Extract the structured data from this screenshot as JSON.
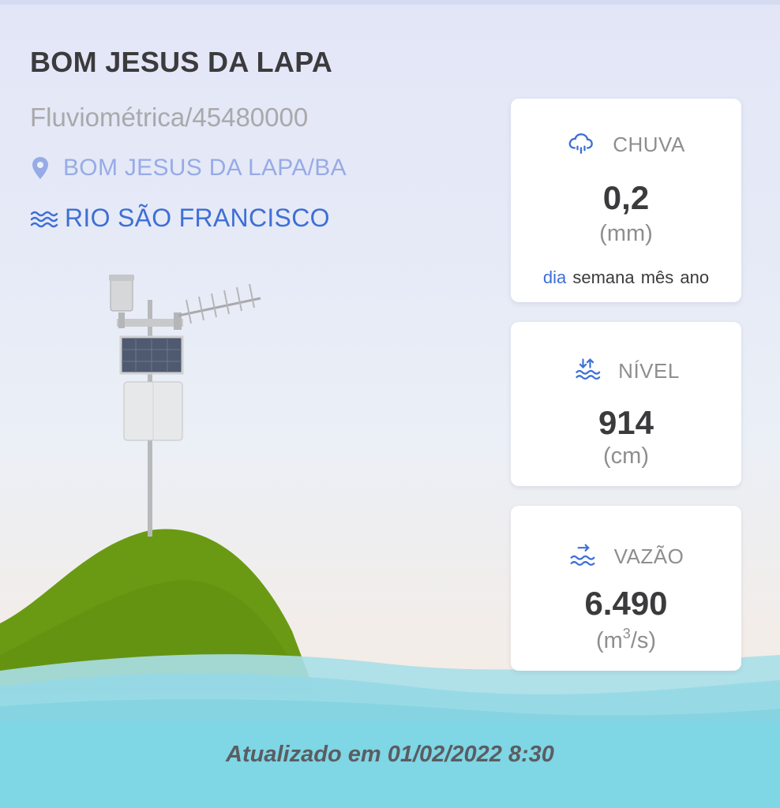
{
  "station": {
    "name": "BOM JESUS DA LAPA",
    "code": "Fluviométrica/45480000",
    "location": "BOM JESUS DA LAPA/BA",
    "river": "RIO SÃO FRANCISCO"
  },
  "icons": {
    "location": "map-pin-icon",
    "river": "water-waves-icon",
    "rain": "cloud-rain-icon",
    "level": "water-level-icon",
    "flow": "water-flow-icon"
  },
  "cards": {
    "rain": {
      "label": "CHUVA",
      "value": "0,2",
      "unit": "(mm)"
    },
    "level": {
      "label": "NÍVEL",
      "value": "914",
      "unit": "(cm)"
    },
    "flow": {
      "label": "VAZÃO",
      "value": "6.490",
      "unit_open": "(m",
      "unit_sup": "3",
      "unit_close": "/s)"
    }
  },
  "periods": {
    "day": "dia",
    "week": "semana",
    "month": "mês",
    "year": "ano",
    "active": "dia"
  },
  "footer": {
    "updated": "Atualizado em 01/02/2022 8:30"
  },
  "colors": {
    "accent": "#3e6fd6",
    "location_text": "#97abe6",
    "title_text": "#3b3b3d",
    "hill_green": "#6a9a14",
    "water": "#7fd6e4"
  }
}
